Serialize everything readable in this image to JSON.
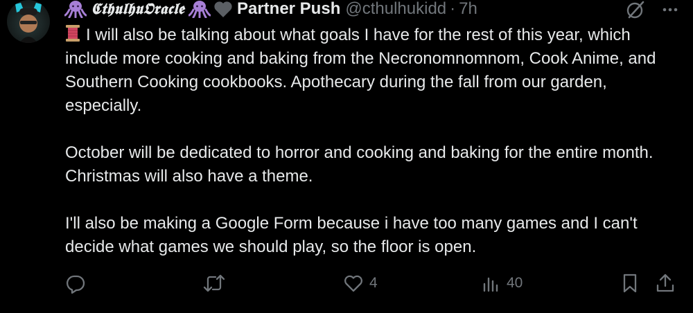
{
  "author": {
    "display_name": "𝕮𝖙𝖍𝖚𝖑𝖍𝖚𝕺𝖗𝖆𝖈𝖑𝖊",
    "partner_label": "Partner Push",
    "handle": "@cthulhukidd",
    "separator": "·",
    "time": "7h"
  },
  "tweet": {
    "paragraphs": [
      "I will also be talking about what goals I have for the rest of this year, which include more cooking and baking from the Necronomnomnom, Cook Anime, and Southern Cooking cookbooks. Apothecary during the fall from our garden, especially.",
      "October will be dedicated to horror and cooking and baking for the entire month. Christmas will also have a theme.",
      "I'll also be making a Google Form because i have too many games and I can't decide what games we should play, so the floor is open."
    ]
  },
  "actions": {
    "likes": "4",
    "views": "40"
  },
  "icons": {
    "octopus": "octopus-icon",
    "heart_badge": "heart-badge-icon",
    "grok": "grok-icon",
    "more": "more-icon",
    "thread": "spool-of-thread-icon",
    "reply": "reply-icon",
    "retweet": "retweet-icon",
    "like": "heart-icon",
    "views": "views-icon",
    "bookmark": "bookmark-icon",
    "share": "share-icon"
  },
  "colors": {
    "background": "#000000",
    "text": "#e7e9ea",
    "muted": "#71767b",
    "octopus": "#a77fd6"
  }
}
